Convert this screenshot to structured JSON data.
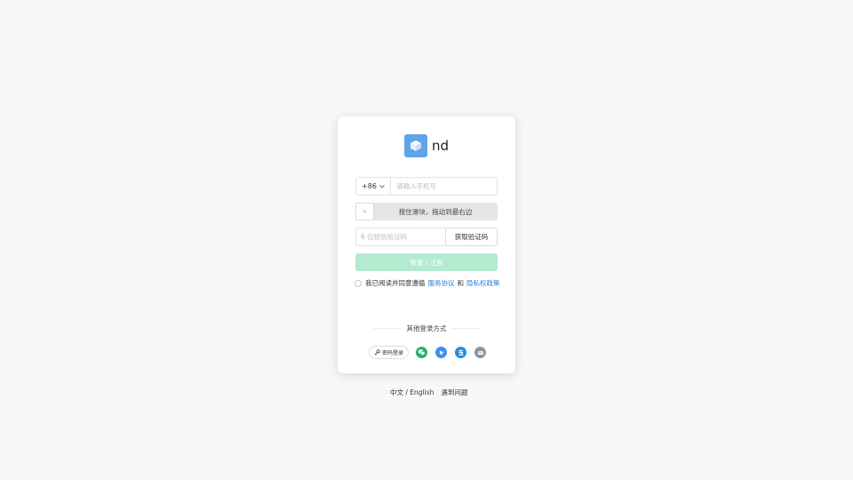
{
  "brand": {
    "name": "nd",
    "logo_icon": "cube-icon",
    "logo_color": "#5fa3e8"
  },
  "form": {
    "country_code": "+86",
    "phone_placeholder": "请输入手机号",
    "slider_text": "按住滑块，拖动到最右边",
    "slider_handle_glyph": "»",
    "sms_placeholder": "6 位短信验证码",
    "sms_button": "获取验证码",
    "login_button": "登录 / 注册",
    "login_button_color": "#b4ead0"
  },
  "agreement": {
    "prefix": "我已阅读并同意遵循",
    "terms": "服务协议",
    "and": "和",
    "privacy": "隐私权政策",
    "link_color": "#2f7bd8"
  },
  "other_login": {
    "title": "其他登录方式",
    "password_login": "密码登录",
    "methods": [
      {
        "icon": "wechat-icon",
        "color": "#2aae67"
      },
      {
        "icon": "dingtalk-icon",
        "color": "#3a8ff0"
      },
      {
        "icon": "alipay-icon",
        "color": "#1b8fe8"
      },
      {
        "icon": "email-icon",
        "color": "#8a96a8"
      }
    ]
  },
  "footer": {
    "language": "中文 / English",
    "help": "遇到问题"
  }
}
